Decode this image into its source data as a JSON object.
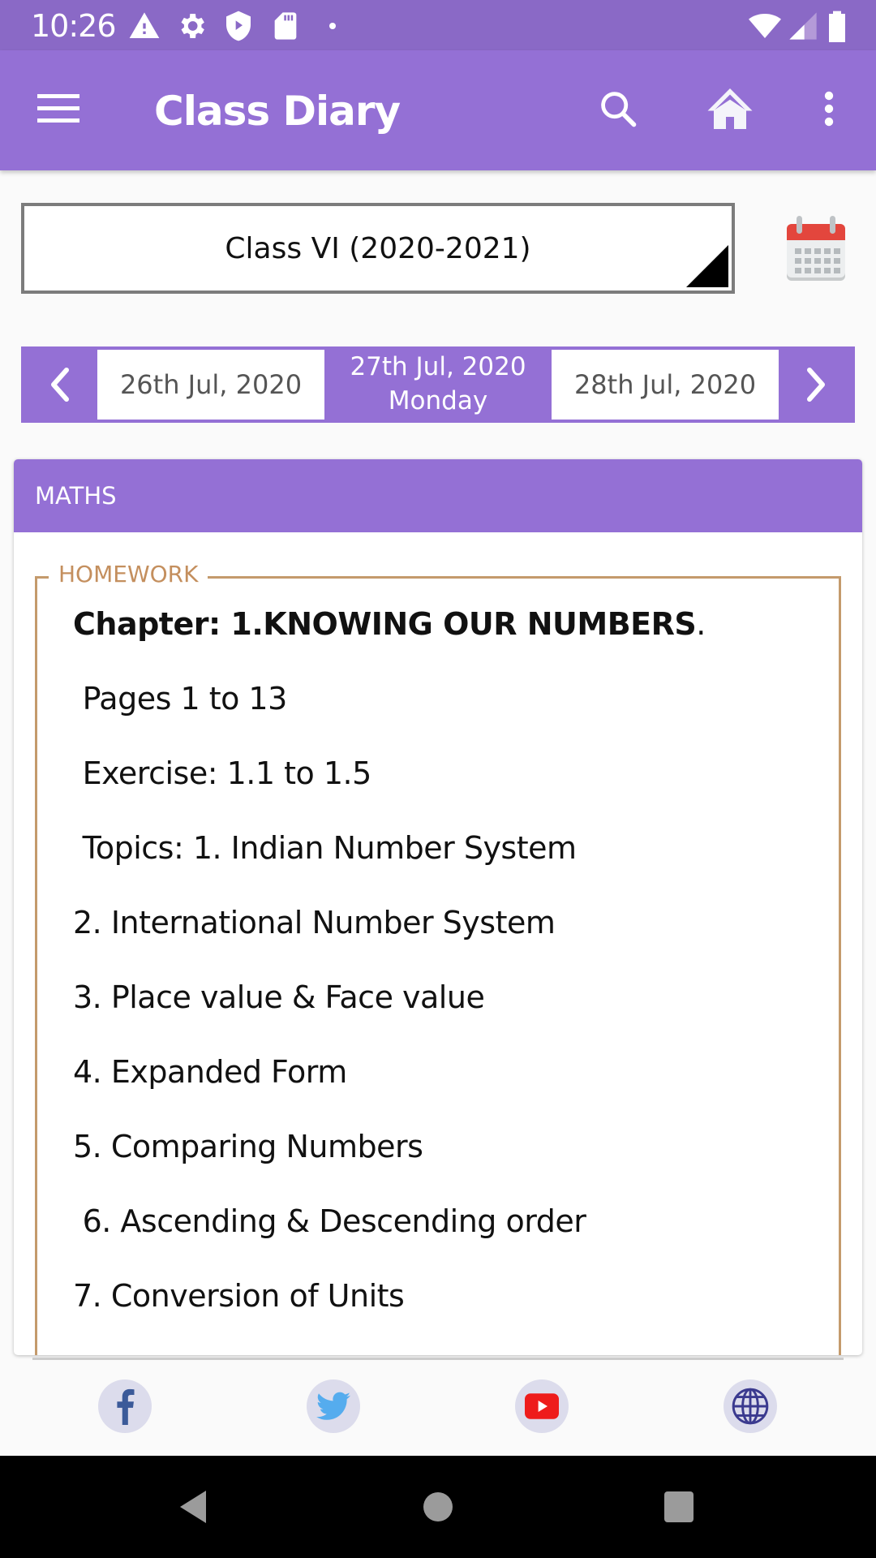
{
  "status_bar": {
    "time": "10:26",
    "left_icons": [
      "warning-icon",
      "settings-gear-icon",
      "shield-play-icon",
      "sd-card-icon",
      "notification-dot-icon"
    ],
    "right_icons": [
      "wifi-icon",
      "cell-signal-icon",
      "battery-icon"
    ]
  },
  "app_bar": {
    "title": "Class Diary",
    "actions": [
      "menu-icon",
      "search-icon",
      "home-icon",
      "more-vert-icon"
    ]
  },
  "class_selector": {
    "selected": "Class VI (2020-2021)"
  },
  "date_nav": {
    "previous_date": "26th Jul, 2020",
    "current_date": "27th Jul, 2020",
    "current_day": "Monday",
    "next_date": "28th Jul, 2020"
  },
  "subject_card": {
    "subject": "MATHS",
    "section_label": "HOMEWORK",
    "chapter_prefix": "Chapter: 1.KNOWING OUR NUMBERS",
    "chapter_suffix": ".",
    "lines": [
      " Pages 1 to 13",
      " Exercise: 1.1 to 1.5",
      " Topics: 1. Indian Number System",
      "2. International Number System",
      "3. Place value & Face value",
      "4. Expanded Form",
      "5. Comparing Numbers",
      " 6. Ascending & Descending order",
      "7. Conversion of Units"
    ]
  },
  "social_links": [
    "facebook",
    "twitter",
    "youtube",
    "website"
  ],
  "colors": {
    "primary": "#9470d5",
    "status_bar": "#8a69c6",
    "homework_border": "#c49a6c",
    "homework_label": "#c48f5e"
  }
}
